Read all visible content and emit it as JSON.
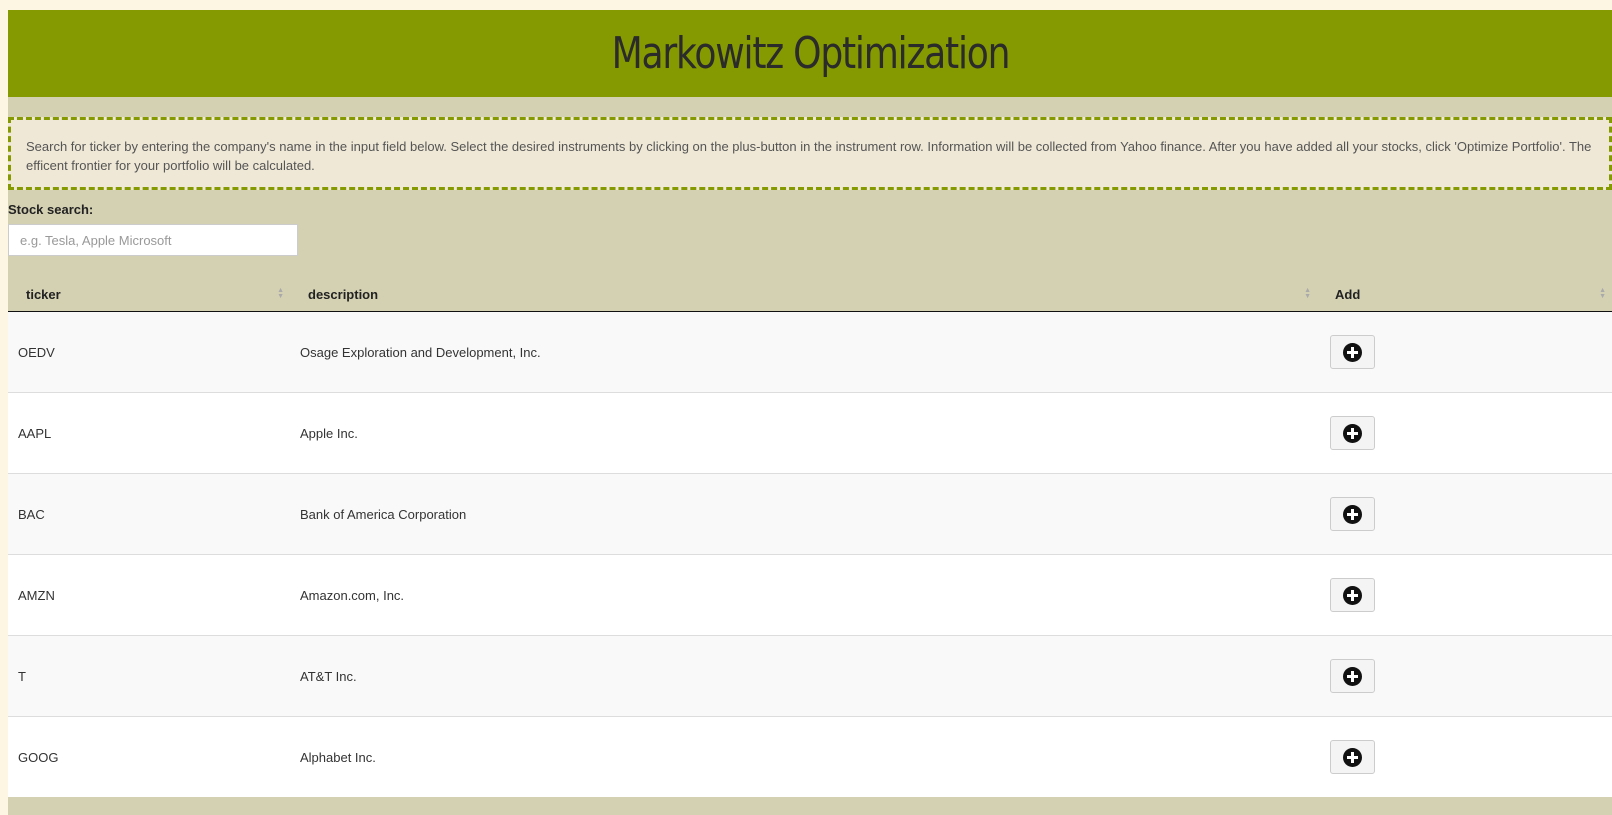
{
  "header": {
    "title": "Markowitz Optimization"
  },
  "info": {
    "text": "Search for ticker by entering the company's name in the input field below. Select the desired instruments by clicking on the plus-button in the instrument row. Information will be collected from Yahoo finance. After you have added all your stocks, click 'Optimize Portfolio'. The efficent frontier for your portfolio will be calculated."
  },
  "search": {
    "label": "Stock search:",
    "placeholder": "e.g. Tesla, Apple Microsoft",
    "value": ""
  },
  "table": {
    "columns": [
      "ticker",
      "description",
      "Add"
    ],
    "rows": [
      {
        "ticker": "OEDV",
        "description": "Osage Exploration and Development, Inc."
      },
      {
        "ticker": "AAPL",
        "description": "Apple Inc."
      },
      {
        "ticker": "BAC",
        "description": "Bank of America Corporation"
      },
      {
        "ticker": "AMZN",
        "description": "Amazon.com, Inc."
      },
      {
        "ticker": "T",
        "description": "AT&T Inc."
      },
      {
        "ticker": "GOOG",
        "description": "Alphabet Inc."
      }
    ]
  },
  "icons": {
    "add": "plus-circle-icon",
    "sort": "sort-icon"
  },
  "colors": {
    "header": "#859900",
    "page_bg": "#d4d1b3",
    "info_bg": "#efe8d6",
    "outer_bg": "#fdf6e3"
  }
}
